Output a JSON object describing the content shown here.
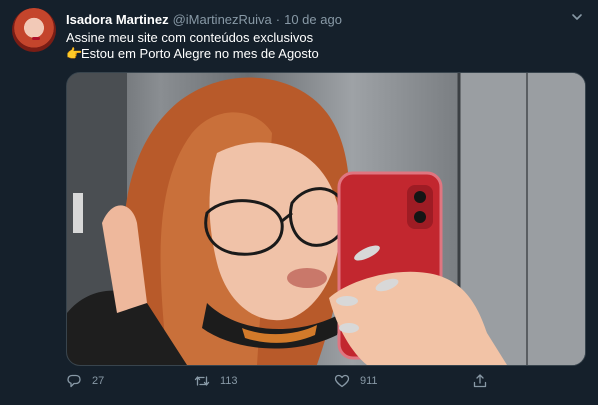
{
  "tweet": {
    "author_name": "Isadora Martinez",
    "handle": "@iMartinezRuiva",
    "separator": "·",
    "time": "10 de ago",
    "line1": "Assine meu site com conteúdos exclusivos",
    "line2_emoji": "👉",
    "line2": "Estou em Porto Alegre no mes de Agosto"
  },
  "actions": {
    "replies": "27",
    "retweets": "113",
    "likes": "911"
  },
  "colors": {
    "background": "#15202b",
    "secondary_text": "#8899a6",
    "phone_case": "#c2272f"
  },
  "icons": [
    "caret-down-icon",
    "reply-icon",
    "retweet-icon",
    "like-icon",
    "share-icon"
  ]
}
